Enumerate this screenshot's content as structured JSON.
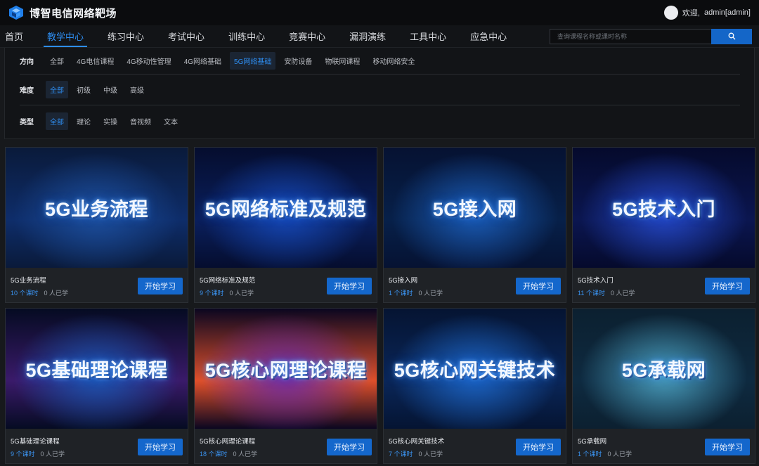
{
  "header": {
    "brand": "博智电信网络靶场",
    "welcome": "欢迎,",
    "username": "admin[admin]"
  },
  "nav": {
    "items": [
      "首页",
      "教学中心",
      "练习中心",
      "考试中心",
      "训练中心",
      "竞赛中心",
      "漏洞演练",
      "工具中心",
      "应急中心"
    ],
    "active": "教学中心",
    "search_placeholder": "查询课程名称或课时名称"
  },
  "filters": {
    "direction": {
      "label": "方向",
      "options": [
        "全部",
        "4G电信课程",
        "4G移动性管理",
        "4G网络基础",
        "5G网络基础",
        "安防设备",
        "物联网课程",
        "移动网络安全"
      ],
      "selected": "5G网络基础"
    },
    "difficulty": {
      "label": "难度",
      "options": [
        "全部",
        "初级",
        "中级",
        "高级"
      ],
      "selected": "全部"
    },
    "type": {
      "label": "类型",
      "options": [
        "全部",
        "理论",
        "实操",
        "音视频",
        "文本"
      ],
      "selected": "全部"
    }
  },
  "courses": [
    {
      "thumb_title": "5G业务流程",
      "name": "5G业务流程",
      "lessons": "10 个课时",
      "learners": "0 人已学",
      "button": "开始学习",
      "theme": [
        "#0a1a3a",
        "#1c4f9e",
        "#0e2d6a"
      ]
    },
    {
      "thumb_title": "5G网络标准及规范",
      "name": "5G网络标准及规范",
      "lessons": "9 个课时",
      "learners": "0 人已学",
      "button": "开始学习",
      "theme": [
        "#050d2e",
        "#1548b8",
        "#0a1f5c"
      ]
    },
    {
      "thumb_title": "5G接入网",
      "name": "5G接入网",
      "lessons": "1 个课时",
      "learners": "0 人已学",
      "button": "开始学习",
      "theme": [
        "#061232",
        "#1a5cb8",
        "#072049"
      ]
    },
    {
      "thumb_title": "5G技术入门",
      "name": "5G技术入门",
      "lessons": "11 个课时",
      "learners": "0 人已学",
      "button": "开始学习",
      "theme": [
        "#050a2c",
        "#2448c8",
        "#0b1650"
      ]
    },
    {
      "thumb_title": "5G基础理论课程",
      "name": "5G基础理论课程",
      "lessons": "9 个课时",
      "learners": "0 人已学",
      "button": "开始学习",
      "theme": [
        "#050b22",
        "#1a57b4",
        "#3a1a6a"
      ]
    },
    {
      "thumb_title": "5G核心网理论课程",
      "name": "5G核心网理论课程",
      "lessons": "18 个课时",
      "learners": "0 人已学",
      "button": "开始学习",
      "theme": [
        "#0a0620",
        "#6a2aa8",
        "#e0502a"
      ]
    },
    {
      "thumb_title": "5G核心网关键技术",
      "name": "5G核心网关键技术",
      "lessons": "7 个课时",
      "learners": "0 人已学",
      "button": "开始学习",
      "theme": [
        "#051432",
        "#1c66c8",
        "#0a2658"
      ]
    },
    {
      "thumb_title": "5G承载网",
      "name": "5G承载网",
      "lessons": "1 个课时",
      "learners": "0 人已学",
      "button": "开始学习",
      "theme": [
        "#0c2030",
        "#4aa0c0",
        "#0e2a40"
      ]
    }
  ],
  "colors": {
    "accent": "#2e8df0",
    "button": "#1467cc",
    "background": "#17191c"
  }
}
